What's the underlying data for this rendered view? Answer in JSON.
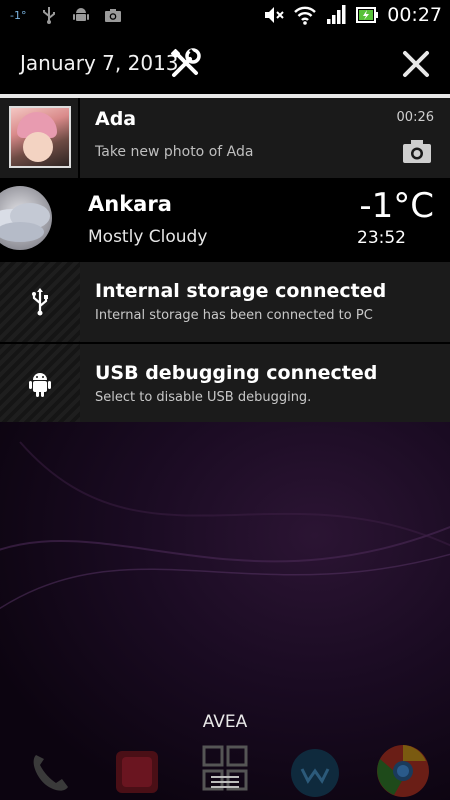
{
  "status_bar": {
    "temperature": "-1°",
    "time": "00:27",
    "left_icons": [
      "usb-icon",
      "android-icon",
      "camera-icon"
    ],
    "right_icons": [
      "mute-icon",
      "wifi-icon",
      "signal-icon",
      "battery-charging-icon"
    ]
  },
  "header": {
    "date": "January 7, 2013",
    "settings_icon": "tools-icon",
    "clear_icon": "close-icon"
  },
  "notifications": {
    "ada": {
      "title": "Ada",
      "subtitle": "Take new photo of Ada",
      "time": "00:26",
      "action_icon": "camera-icon"
    },
    "weather": {
      "city": "Ankara",
      "condition": "Mostly Cloudy",
      "temperature": "-1°C",
      "time": "23:52"
    },
    "storage": {
      "title": "Internal storage connected",
      "subtitle": "Internal storage has been connected to PC",
      "icon": "usb-icon"
    },
    "usb_debug": {
      "title": "USB debugging connected",
      "subtitle": "Select to disable USB debugging.",
      "icon": "android-icon"
    }
  },
  "carrier": "AVEA",
  "dock": [
    "phone-icon",
    "media-icon",
    "apps-grid-icon",
    "walkman-icon",
    "chrome-icon"
  ],
  "colors": {
    "accent_blue": "#7ab3e0",
    "panel_bg": "#1b1b1b",
    "divider": "#e8e8e8"
  }
}
